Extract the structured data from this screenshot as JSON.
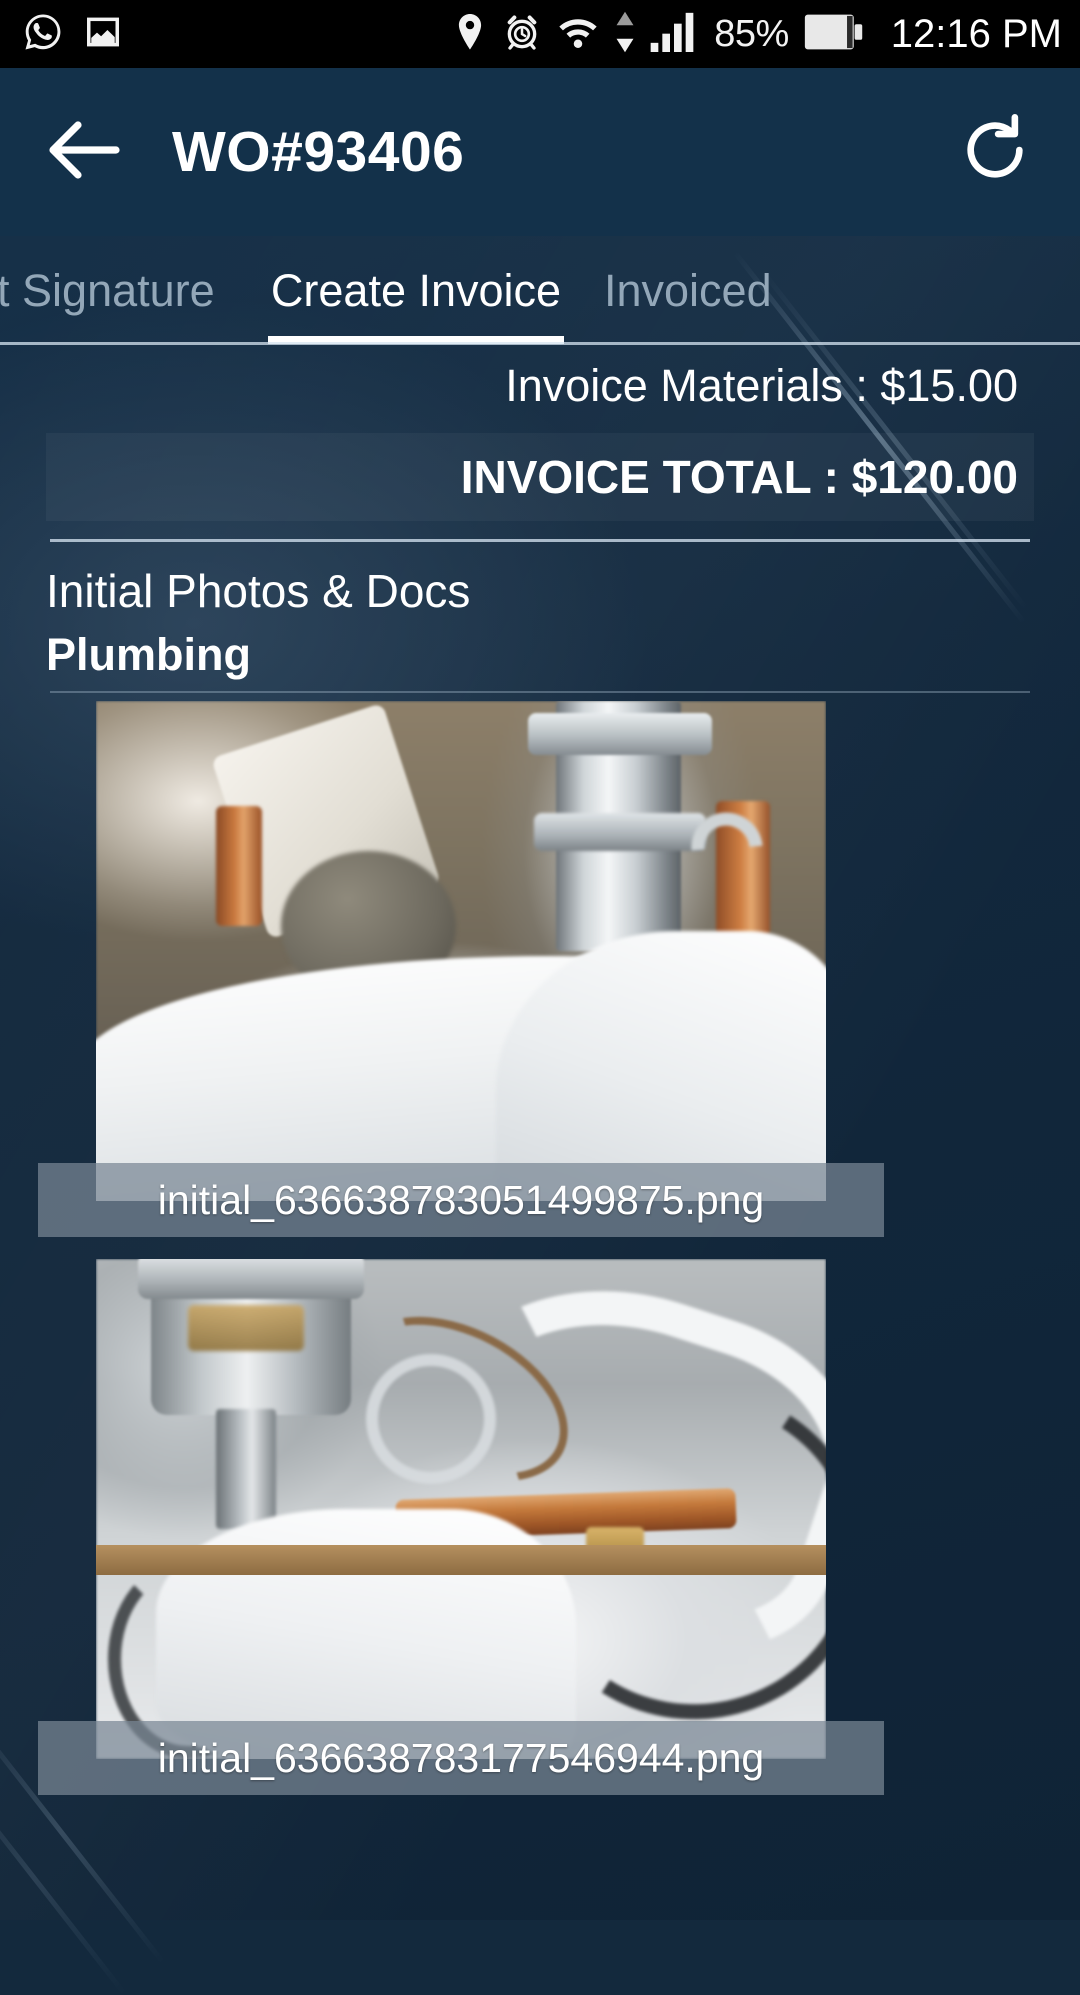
{
  "statusbar": {
    "icons": [
      "whatsapp-icon",
      "image-icon",
      "location-pin-icon",
      "alarm-clock-icon",
      "wifi-icon",
      "data-transfer-icon",
      "signal-bars-icon"
    ],
    "battery_percent": "85%",
    "time": "12:16 PM"
  },
  "appbar": {
    "back_icon": "arrow-left-icon",
    "title": "WO#93406",
    "refresh_icon": "refresh-icon"
  },
  "tabs": [
    {
      "label": "nt Signature",
      "active": false
    },
    {
      "label": "Create Invoice",
      "active": true
    },
    {
      "label": "Invoiced",
      "active": false
    }
  ],
  "invoice": {
    "materials_line": "Invoice Materials : $15.00",
    "materials_label": "Invoice Materials",
    "materials_value": "$15.00",
    "total_line": "INVOICE TOTAL : $120.00",
    "total_label": "INVOICE TOTAL",
    "total_value": "$120.00"
  },
  "documents": {
    "section_title": "Initial Photos & Docs",
    "category": "Plumbing",
    "photos": [
      {
        "filename": "initial_636638783051499875.png"
      },
      {
        "filename": "initial_636638783177546944.png"
      }
    ]
  },
  "colors": {
    "statusbar_bg": "#000000",
    "appbar_bg": "#13314a",
    "page_bg": "#13293d",
    "active_tab": "#ffffff",
    "inactive_tab": "#93a7b8",
    "caption_bg": "rgba(120,135,148,0.72)"
  }
}
